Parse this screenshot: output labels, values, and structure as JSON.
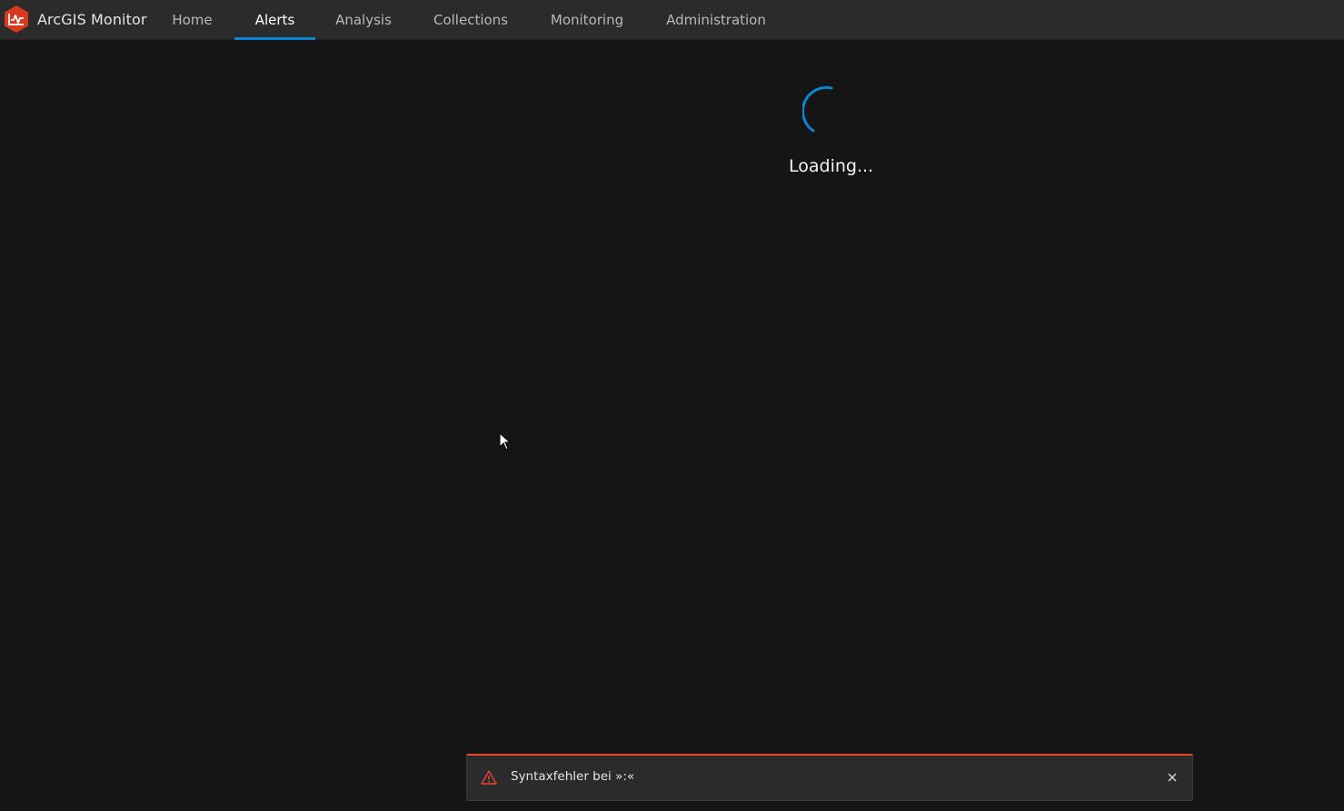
{
  "app": {
    "title": "ArcGIS Monitor",
    "logo_icon": "arcgis-monitor-logo-icon",
    "brand_color": "#d83a20"
  },
  "nav": {
    "items": [
      {
        "label": "Home",
        "active": false
      },
      {
        "label": "Alerts",
        "active": true
      },
      {
        "label": "Analysis",
        "active": false
      },
      {
        "label": "Collections",
        "active": false
      },
      {
        "label": "Monitoring",
        "active": false
      },
      {
        "label": "Administration",
        "active": false
      }
    ],
    "active_indicator_color": "#0b84d4"
  },
  "main": {
    "loading_text": "Loading...",
    "spinner_color": "#0b84d4"
  },
  "toast": {
    "message": "Syntaxfehler bei »:«",
    "icon": "warning-triangle-icon",
    "close_icon": "close-icon",
    "accent_color": "#e8452f"
  }
}
